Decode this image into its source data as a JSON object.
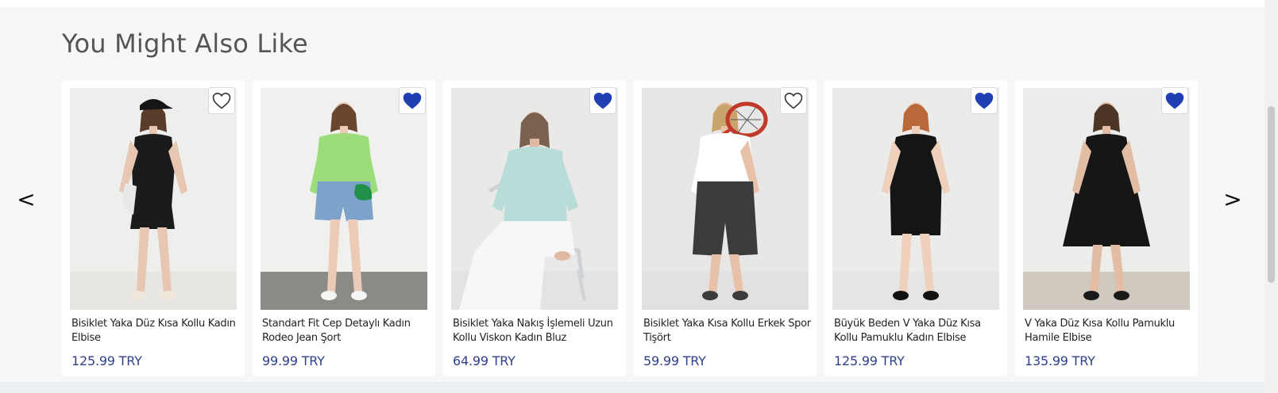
{
  "section": {
    "title": "You Might Also Like"
  },
  "carousel": {
    "prev_label": "<",
    "next_label": ">",
    "products": [
      {
        "name": "Bisiklet Yaka Düz Kısa Kollu Kadın Elbise",
        "price": "125.99 TRY",
        "favorited": false,
        "photo": "model-in-black-tshirt-dress",
        "bg": "#eeeeec",
        "floor": "#e7e6e3",
        "top_color": "#1b1b1b",
        "bottom_color": "#1b1b1b",
        "skin": "#e7c7b2",
        "hair": "#5a3c2a",
        "shoes": "#efe8da"
      },
      {
        "name": "Standart Fit Cep Detaylı Kadın Rodeo Jean Şort",
        "price": "99.99 TRY",
        "favorited": true,
        "photo": "model-in-denim-shorts",
        "bg": "#f0f0ef",
        "floor": "#8c8a86",
        "top_color": "#9ddc7a",
        "bottom_color": "#7ea3cb",
        "skin": "#eccbb6",
        "hair": "#6a4630",
        "shoes": "#f5f5f5"
      },
      {
        "name": "Bisiklet Yaka Nakış İşlemeli Uzun Kollu Viskon Kadın Bluz",
        "price": "64.99 TRY",
        "favorited": true,
        "photo": "seated-model-in-floral-blouse",
        "bg": "#e9e9e8",
        "floor": "#e3e3e2",
        "top_color": "#b8dcd8",
        "bottom_color": "#f7f7f5",
        "skin": "#dfb9a2",
        "hair": "#7b6150",
        "shoes": "#f2f2f2"
      },
      {
        "name": "Bisiklet Yaka Kısa Kollu Erkek Spor Tişört",
        "price": "59.99 TRY",
        "favorited": false,
        "photo": "model-with-tennis-racket",
        "bg": "#e8e7e5",
        "floor": "#e2e1df",
        "top_color": "#ffffff",
        "bottom_color": "#3a3b3d",
        "skin": "#e8c2a8",
        "hair": "#c9a46c",
        "shoes": "#3a3b3d"
      },
      {
        "name": "Büyük Beden V Yaka Düz Kısa Kollu Pamuklu Kadın Elbise",
        "price": "125.99 TRY",
        "favorited": true,
        "photo": "model-in-long-black-dress",
        "bg": "#ebebea",
        "floor": "#e6e5e3",
        "top_color": "#151515",
        "bottom_color": "#151515",
        "skin": "#efd0bc",
        "hair": "#b9683a",
        "shoes": "#111111"
      },
      {
        "name": "V Yaka Düz Kısa Kollu Pamuklu Hamile Elbise",
        "price": "135.99 TRY",
        "favorited": true,
        "photo": "model-in-black-maternity-dress",
        "bg": "#ececea",
        "floor": "#cfc9c0",
        "top_color": "#161616",
        "bottom_color": "#161616",
        "skin": "#e3bca4",
        "hair": "#4d3526",
        "shoes": "#1a1a1a"
      }
    ]
  },
  "colors": {
    "heart_filled": "#1f3fb3",
    "heart_outline": "#333333",
    "price": "#2e3f8c"
  },
  "icons": {
    "favorite": "heart-icon",
    "prev": "chevron-left-icon",
    "next": "chevron-right-icon"
  }
}
